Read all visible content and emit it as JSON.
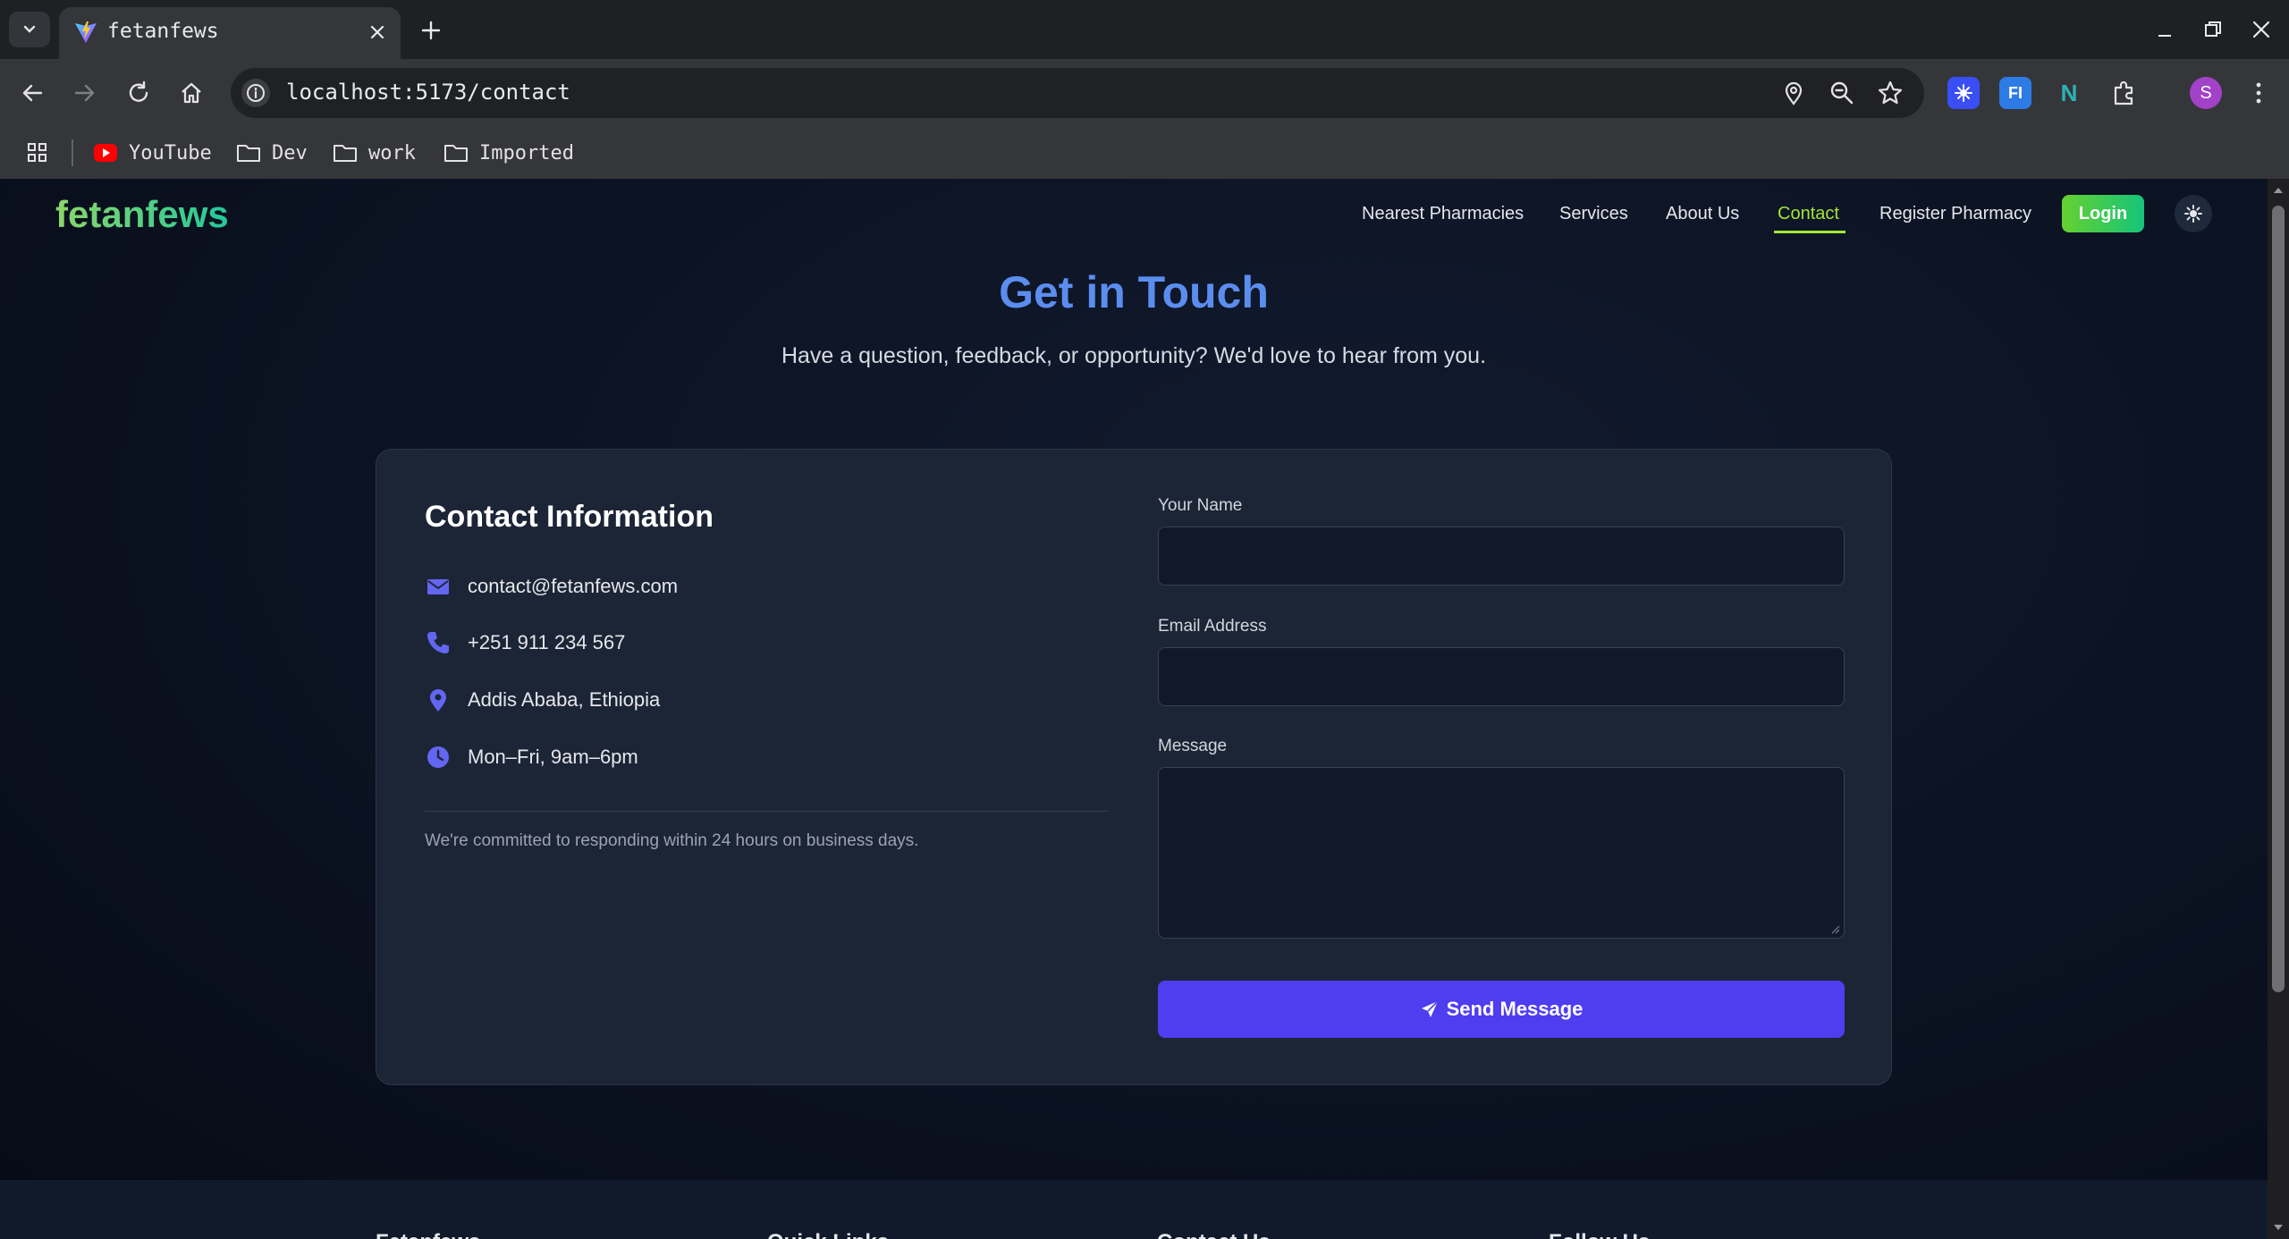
{
  "browser": {
    "tab_title": "fetanfews",
    "url": "localhost:5173/contact",
    "bookmarks": [
      "YouTube",
      "Dev",
      "work",
      "Imported"
    ],
    "profile_initial": "S",
    "extensions": [
      "color-extension",
      "FI",
      "N"
    ]
  },
  "nav": {
    "logo": "fetanfews",
    "links": [
      "Nearest Pharmacies",
      "Services",
      "About Us",
      "Contact",
      "Register Pharmacy"
    ],
    "active": "Contact",
    "login": "Login"
  },
  "hero": {
    "title": "Get in Touch",
    "subtitle": "Have a question, feedback, or opportunity? We'd love to hear from you."
  },
  "contact_info": {
    "title": "Contact Information",
    "items": [
      {
        "icon": "envelope-icon",
        "text": "contact@fetanfews.com"
      },
      {
        "icon": "phone-icon",
        "text": "+251 911 234 567"
      },
      {
        "icon": "map-pin-icon",
        "text": "Addis Ababa, Ethiopia"
      },
      {
        "icon": "clock-icon",
        "text": "Mon–Fri, 9am–6pm"
      }
    ],
    "commitment": "We're committed to responding within 24 hours on business days."
  },
  "form": {
    "name_label": "Your Name",
    "name_value": "",
    "email_label": "Email Address",
    "email_value": "",
    "message_label": "Message",
    "message_value": "",
    "submit": "Send Message"
  },
  "footer": {
    "headings": [
      "Fetanfews",
      "Quick Links",
      "Contact Us",
      "Follow Us"
    ]
  },
  "colors": {
    "accent": "#5b8def",
    "button": "#4f3df0",
    "active_link": "#a3e635",
    "icon": "#6366f1"
  }
}
